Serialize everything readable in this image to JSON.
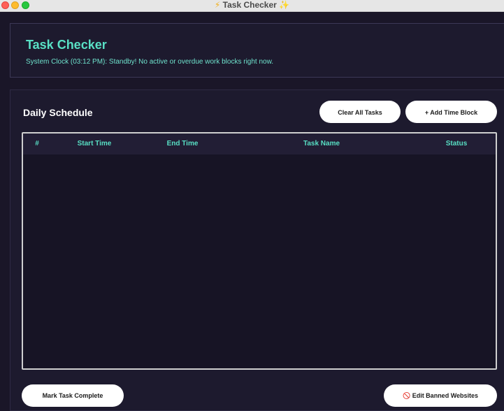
{
  "window": {
    "title": "Task Checker",
    "title_emoji_left": "⚡",
    "title_emoji_right": "✨"
  },
  "header": {
    "app_title": "Task Checker",
    "status_line": "System Clock (03:12 PM): Standby! No active or overdue work blocks right now."
  },
  "schedule": {
    "section_title": "Daily Schedule",
    "clear_button": "Clear All Tasks",
    "add_button": "+ Add Time Block",
    "columns": {
      "number": "#",
      "start": "Start Time",
      "end": "End Time",
      "task": "Task Name",
      "status": "Status"
    },
    "rows": []
  },
  "footer": {
    "complete_button": "Mark Task Complete",
    "banned_icon": "🚫",
    "banned_button": "Edit Banned Websites"
  },
  "colors": {
    "accent": "#59e0c5",
    "background": "#1a1628",
    "panel": "#1d1a2e"
  }
}
